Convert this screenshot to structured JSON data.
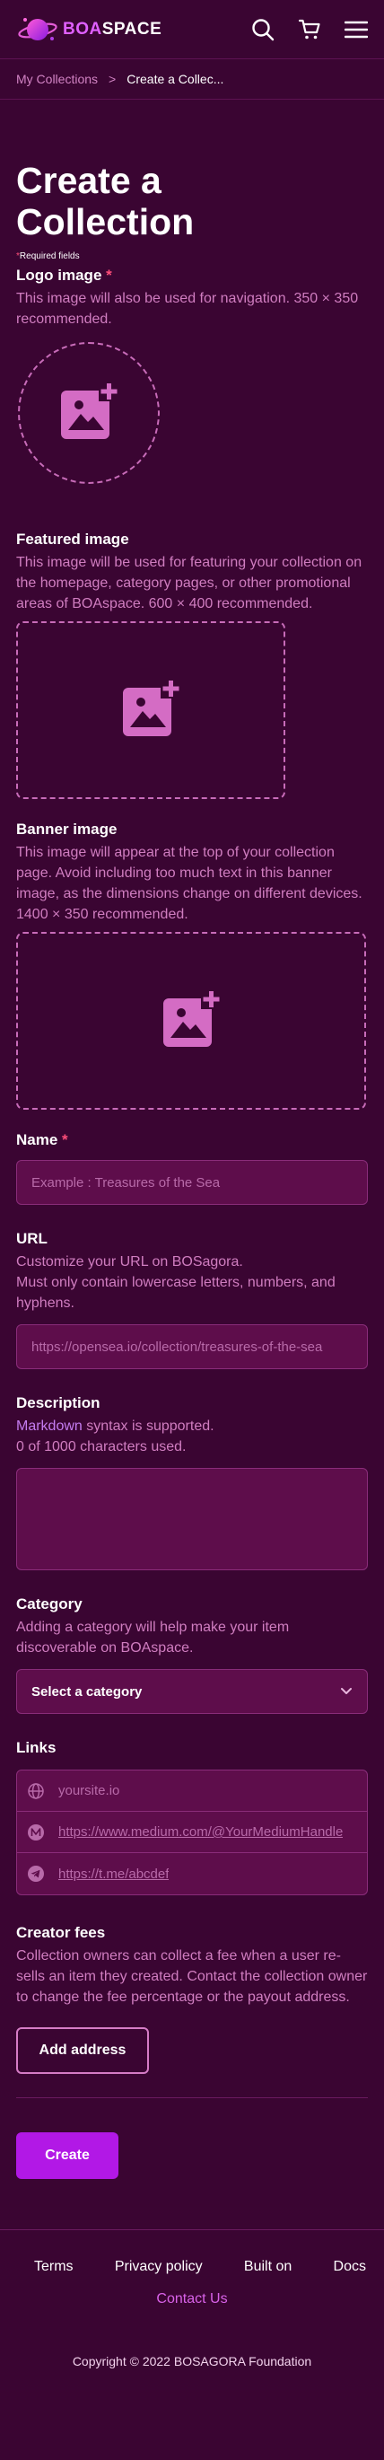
{
  "brand": {
    "boa": "BOA",
    "space": "SPACE"
  },
  "breadcrumb": {
    "parent": "My Collections",
    "separator": ">",
    "current": "Create a Collec..."
  },
  "page": {
    "title": "Create a Collection",
    "required_star": "*",
    "required_note": "Required fields"
  },
  "logo_image": {
    "label": "Logo image",
    "star": "*",
    "desc": "This image will also be used for navigation. 350 × 350 recommended."
  },
  "featured_image": {
    "label": "Featured image",
    "desc": "This image will be used for featuring your collection on the homepage, category pages, or other promotional areas of BOAspace. 600 × 400 recommended."
  },
  "banner_image": {
    "label": "Banner image",
    "desc": "This image will appear at the top of your collection page. Avoid including too much text in this banner image, as the dimensions change on different devices. 1400 × 350 recommended."
  },
  "name": {
    "label": "Name",
    "star": "*",
    "placeholder": "Example : Treasures of the Sea"
  },
  "url": {
    "label": "URL",
    "desc_line1": "Customize your URL on BOSagora.",
    "desc_line2": "Must only contain lowercase letters, numbers, and hyphens.",
    "placeholder": "https://opensea.io/collection/treasures-of-the-sea"
  },
  "description": {
    "label": "Description",
    "link": "Markdown",
    "desc_rest": " syntax is supported.",
    "counter": "0 of 1000 characters used."
  },
  "category": {
    "label": "Category",
    "desc": "Adding a category will help make your item discoverable on BOAspace.",
    "select": "Select a category"
  },
  "links": {
    "label": "Links",
    "items": [
      {
        "icon": "globe-icon",
        "text": "yoursite.io"
      },
      {
        "icon": "medium-icon",
        "text": "https://www.medium.com/@YourMediumHandle"
      },
      {
        "icon": "telegram-icon",
        "text": "https://t.me/abcdef"
      }
    ]
  },
  "creator_fees": {
    "label": "Creator fees",
    "desc": "Collection owners can collect a fee when a user re-sells an item they created. Contact the collection owner to change the fee percentage or the payout address.",
    "button": "Add address"
  },
  "actions": {
    "create": "Create"
  },
  "footer": {
    "terms": "Terms",
    "privacy": "Privacy policy",
    "built_on": "Built on",
    "docs": "Docs",
    "contact": "Contact Us",
    "copyright": "Copyright © 2022 BOSAGORA Foundation"
  },
  "colors": {
    "background": "#3a0532",
    "accent": "#b218e6",
    "input_bg": "#5e0d4b",
    "muted_text": "#d07dc0",
    "required": "#ff4e7a"
  }
}
